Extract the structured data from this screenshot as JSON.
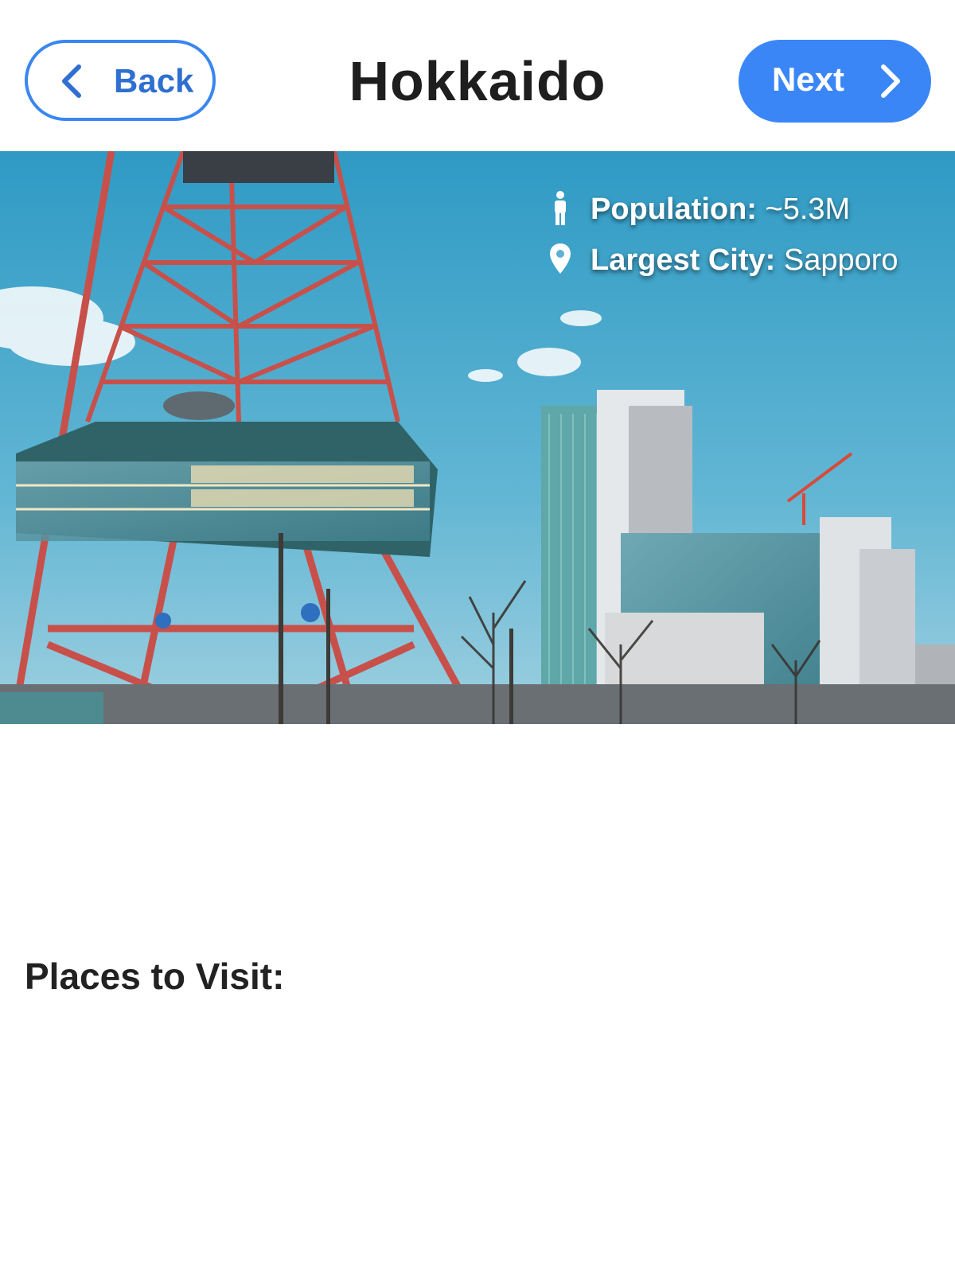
{
  "header": {
    "title": "Hokkaido",
    "back_label": "Back",
    "next_label": "Next"
  },
  "hero": {
    "image_subject": "Sapporo TV Tower and city skyline",
    "facts": [
      {
        "icon": "person-icon",
        "label": "Population:",
        "value": "~5.3M"
      },
      {
        "icon": "map-pin-icon",
        "label": "Largest City:",
        "value": "Sapporo"
      }
    ]
  },
  "sections": {
    "places_heading": "Places to Visit:"
  },
  "colors": {
    "accent": "#3a86f7",
    "back_border": "#3a86f0",
    "title_text": "#1e1e1e",
    "sky_top": "#2f9ac4",
    "sky_bottom": "#9fd0e0",
    "tower_red": "#c8504a"
  }
}
